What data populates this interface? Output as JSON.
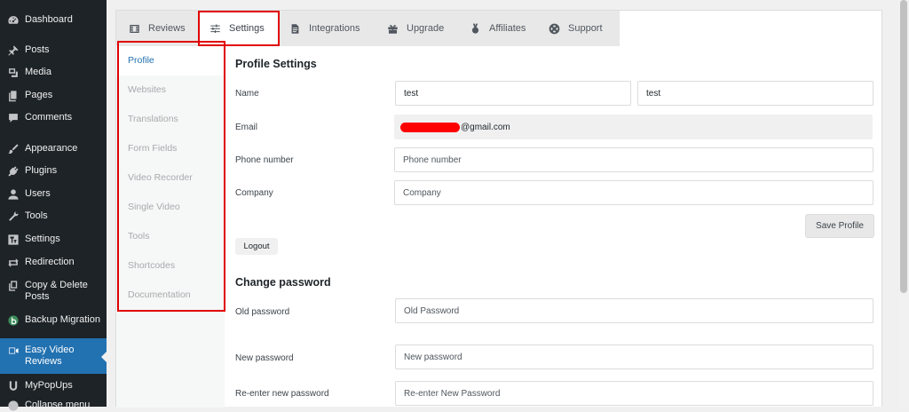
{
  "wp_menu": [
    {
      "label": "Dashboard",
      "icon": "dashboard-icon",
      "top": 0
    },
    {
      "label": "Posts",
      "icon": "pin-icon"
    },
    {
      "label": "Media",
      "icon": "media-icon"
    },
    {
      "label": "Pages",
      "icon": "pages-icon"
    },
    {
      "label": "Comments",
      "icon": "comment-icon"
    },
    {
      "label": "Appearance",
      "icon": "brush-icon"
    },
    {
      "label": "Plugins",
      "icon": "plugin-icon"
    },
    {
      "label": "Users",
      "icon": "user-icon"
    },
    {
      "label": "Tools",
      "icon": "wrench-icon"
    },
    {
      "label": "Settings",
      "icon": "settings-icon"
    },
    {
      "label": "Redirection",
      "icon": "redirect-icon"
    },
    {
      "label": "Copy & Delete Posts",
      "icon": "copy-icon"
    },
    {
      "label": "Backup Migration",
      "icon": "backup-icon"
    },
    {
      "label": "Easy Video Reviews",
      "icon": "video-icon",
      "active": true
    },
    {
      "label": "MyPopUps",
      "icon": "popup-icon"
    },
    {
      "label": "Collapse menu",
      "icon": "collapse-icon"
    }
  ],
  "tabs": [
    {
      "label": "Reviews",
      "icon": "film-icon"
    },
    {
      "label": "Settings",
      "icon": "sliders-icon",
      "active": true
    },
    {
      "label": "Integrations",
      "icon": "document-icon"
    },
    {
      "label": "Upgrade",
      "icon": "gift-icon"
    },
    {
      "label": "Affiliates",
      "icon": "medal-icon"
    },
    {
      "label": "Support",
      "icon": "lifebuoy-icon"
    }
  ],
  "subnav": [
    {
      "label": "Profile",
      "active": true
    },
    {
      "label": "Websites"
    },
    {
      "label": "Translations"
    },
    {
      "label": "Form Fields"
    },
    {
      "label": "Video Recorder"
    },
    {
      "label": "Single Video"
    },
    {
      "label": "Tools"
    },
    {
      "label": "Shortcodes"
    },
    {
      "label": "Documentation"
    }
  ],
  "profile": {
    "title": "Profile Settings",
    "name_label": "Name",
    "first_name": "test",
    "last_name": "test",
    "email_label": "Email",
    "email_visible": "@gmail.com",
    "phone_label": "Phone number",
    "phone_placeholder": "Phone number",
    "company_label": "Company",
    "company_placeholder": "Company",
    "save_button": "Save Profile",
    "logout_button": "Logout"
  },
  "password": {
    "title": "Change password",
    "old_label": "Old password",
    "old_placeholder": "Old Password",
    "new_label": "New password",
    "new_placeholder": "New password",
    "reenter_label": "Re-enter new password",
    "reenter_placeholder": "Re-enter New Password"
  },
  "colors": {
    "highlight": "#e00000",
    "accent": "#2271b1",
    "sidebar_bg": "#1d2327"
  }
}
